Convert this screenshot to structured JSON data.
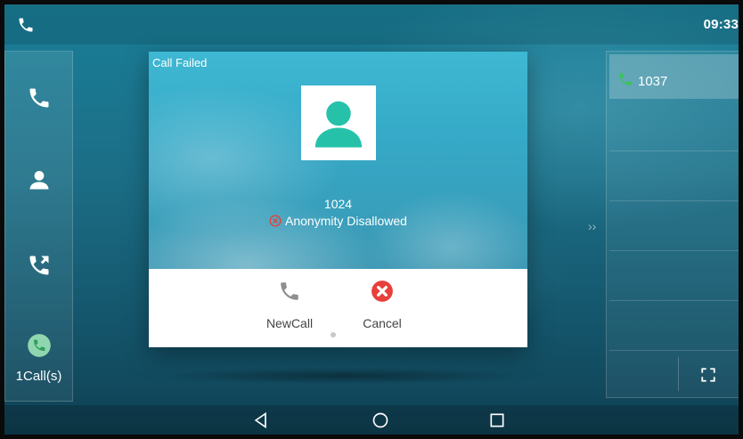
{
  "status_bar": {
    "time": "09:33",
    "icon": "phone-icon"
  },
  "sidebar": {
    "items": [
      {
        "icon": "phone-icon"
      },
      {
        "icon": "contacts-icon"
      },
      {
        "icon": "call-forward-icon"
      },
      {
        "icon": "active-call-icon"
      }
    ],
    "calls_label": "1Call(s)"
  },
  "dialog": {
    "title": "Call Failed",
    "avatar_icon": "contact-avatar-icon",
    "caller_number": "1024",
    "status_text": "Anonymity Disallowed",
    "status_icon": "error-circle-icon",
    "actions": [
      {
        "label": "NewCall",
        "icon": "phone-icon"
      },
      {
        "label": "Cancel",
        "icon": "cancel-icon"
      }
    ],
    "colors": {
      "avatar": "#25c2a9",
      "cancel": "#e8403b",
      "newcall_icon": "#8f8f8f"
    }
  },
  "right_panel": {
    "calls": [
      {
        "number": "1037",
        "icon": "phone-icon"
      }
    ],
    "fullscreen_icon": "fullscreen-icon"
  },
  "nav_bar": {
    "back_icon": "back-icon",
    "home_icon": "home-icon",
    "recents_icon": "recents-icon"
  },
  "colors": {
    "accent_green": "#3cc35a"
  }
}
